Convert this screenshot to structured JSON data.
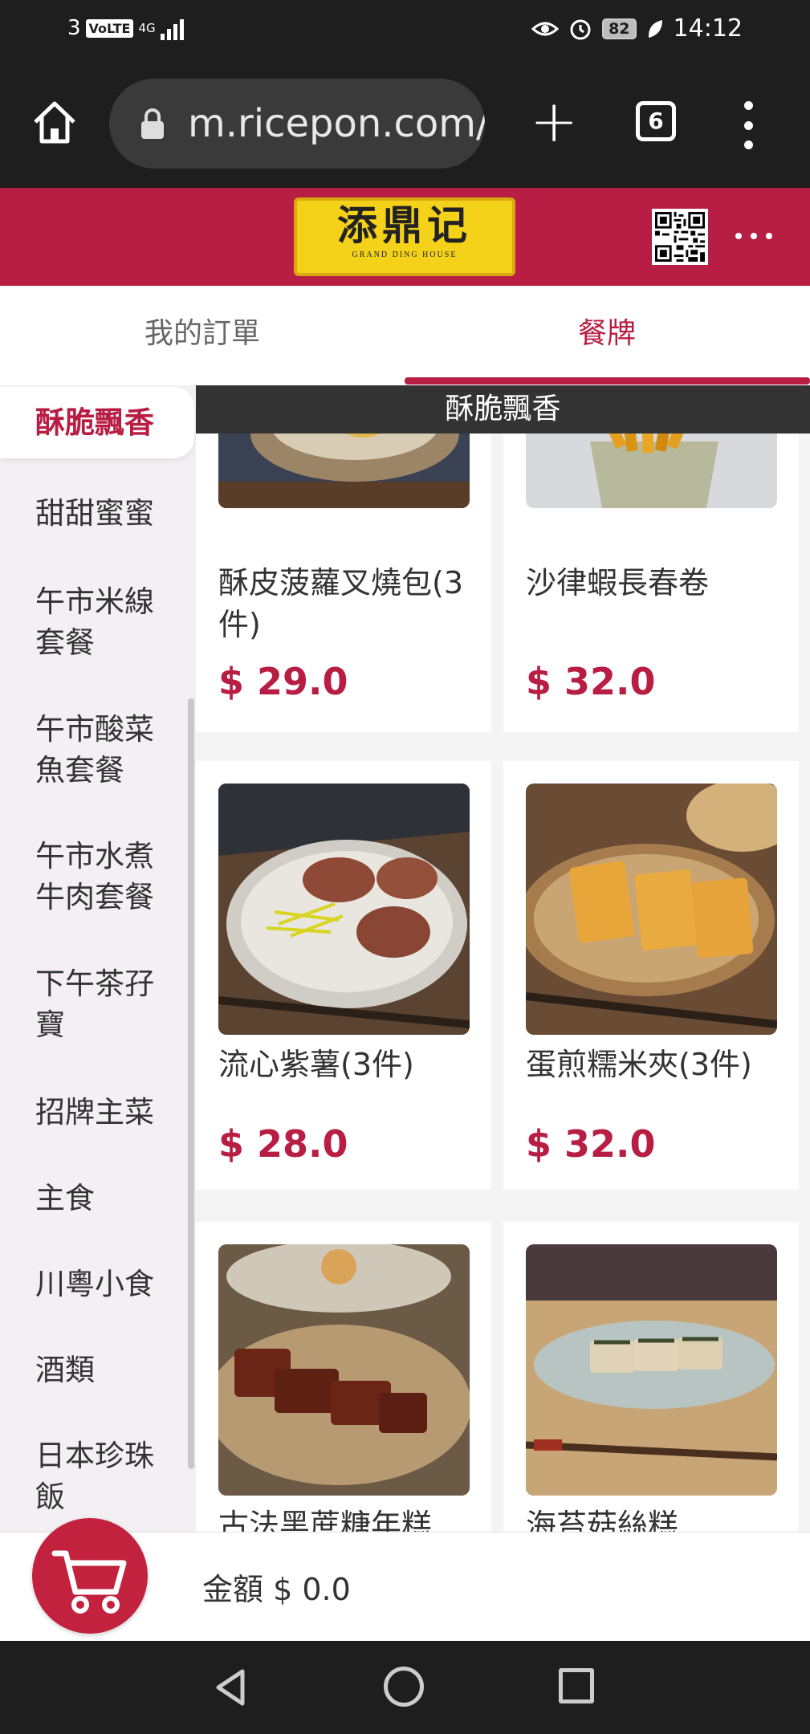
{
  "status_bar": {
    "sim": "3",
    "volte": "VoLTE",
    "network": "4G",
    "battery": "82",
    "time": "14:12"
  },
  "browser": {
    "url": "m.ricepon.com/",
    "tab_count": "6"
  },
  "restaurant": {
    "logo_text": "添鼎记",
    "logo_subtitle": "GRAND DING HOUSE"
  },
  "tabs": {
    "orders": "我的訂單",
    "menu": "餐牌"
  },
  "categories": [
    {
      "label": "酥脆飄香",
      "active": true
    },
    {
      "label": "甜甜蜜蜜"
    },
    {
      "label": "午市米線套餐"
    },
    {
      "label": "午市酸菜魚套餐"
    },
    {
      "label": "午市水煮牛肉套餐"
    },
    {
      "label": "下午茶孖寶"
    },
    {
      "label": "招牌主菜"
    },
    {
      "label": "主食"
    },
    {
      "label": "川粵小食"
    },
    {
      "label": "酒類"
    },
    {
      "label": "日本珍珠飯"
    }
  ],
  "section_title": "酥脆飄香",
  "items": [
    {
      "name": "酥皮菠蘿叉燒包(3件)",
      "price": "$ 29.0"
    },
    {
      "name": "沙律蝦長春卷",
      "price": "$ 32.0"
    },
    {
      "name": "流心紫薯(3件)",
      "price": "$ 28.0"
    },
    {
      "name": "蛋煎糯米夾(3件)",
      "price": "$ 32.0"
    },
    {
      "name": "古法黑蔗糖年糕",
      "price": ""
    },
    {
      "name": "海苔菇絲糕",
      "price": ""
    }
  ],
  "cart": {
    "total_label": "金額 $ 0.0"
  },
  "colors": {
    "brand": "#b81d44",
    "status_bar": "#1e1e1e"
  }
}
